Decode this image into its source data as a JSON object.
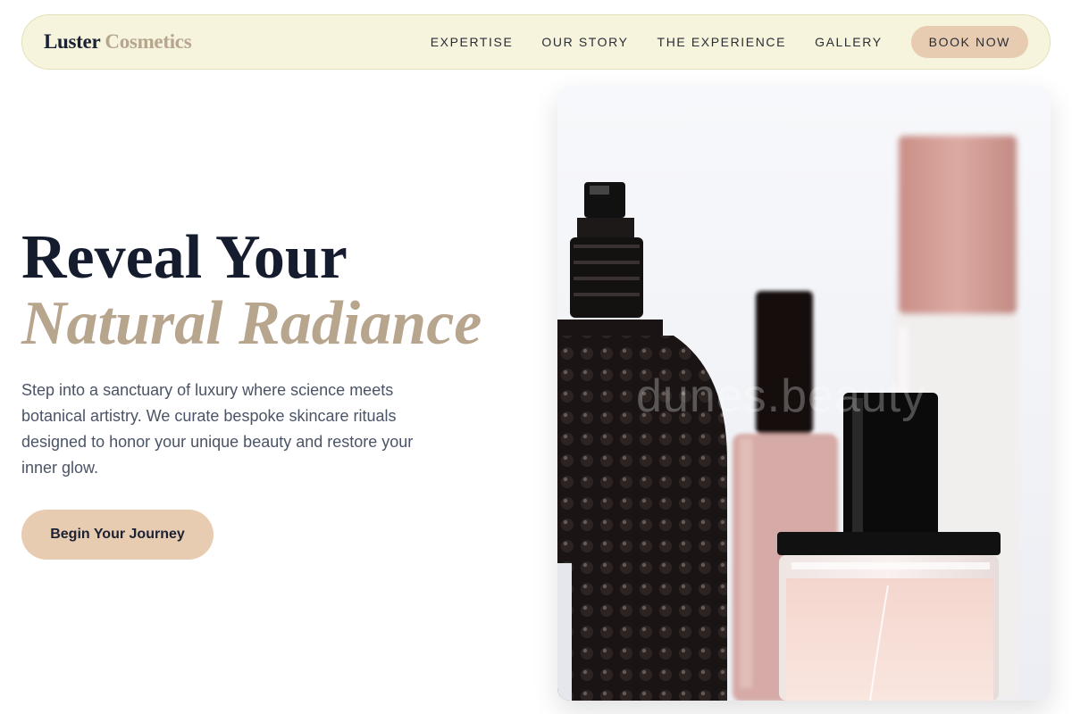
{
  "brand": {
    "name_part1": "Luster",
    "name_part2": "Cosmetics"
  },
  "nav": {
    "links": [
      "EXPERTISE",
      "OUR STORY",
      "THE EXPERIENCE",
      "GALLERY"
    ],
    "cta_label": "BOOK NOW"
  },
  "hero": {
    "title_line1": "Reveal Your",
    "title_line2": "Natural Radiance",
    "description": "Step into a sanctuary of luxury where science meets botanical artistry. We curate bespoke skincare rituals designed to honor your unique beauty and restore your inner glow.",
    "cta_label": "Begin Your Journey",
    "image_watermark": "dunes.beauty"
  },
  "colors": {
    "nav_background": "#f6f4dd",
    "accent_beige": "#e8ccb1",
    "accent_text": "#b8a58e",
    "heading_dark": "#141c2e",
    "body_text": "#4b5466"
  }
}
